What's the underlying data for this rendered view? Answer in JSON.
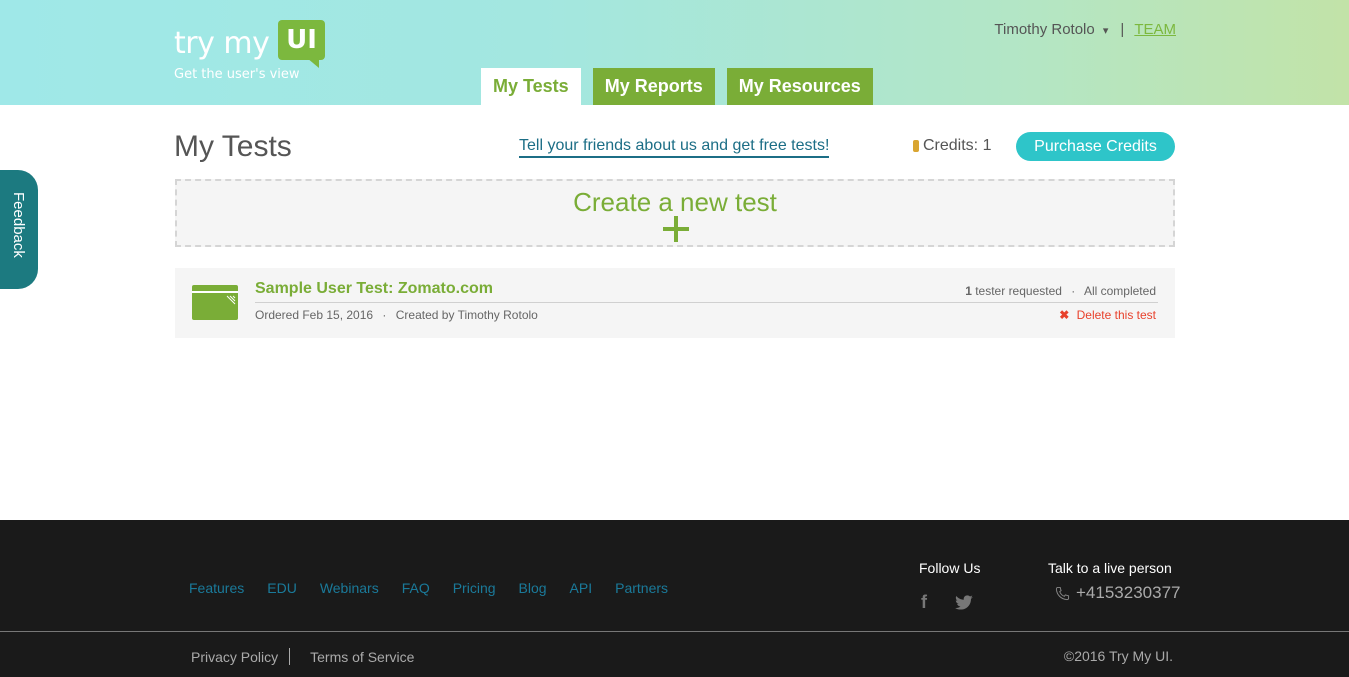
{
  "header": {
    "logo": {
      "text": "try my",
      "badge": "UI",
      "tagline": "Get the user's view"
    },
    "user": {
      "name": "Timothy Rotolo",
      "caret": "▾",
      "separator": "|",
      "team_label": "TEAM"
    },
    "tabs": [
      {
        "label": "My Tests",
        "active": true
      },
      {
        "label": "My Reports",
        "active": false
      },
      {
        "label": "My Resources",
        "active": false
      }
    ]
  },
  "feedback": {
    "label": "Feedback"
  },
  "main": {
    "title": "My Tests",
    "referral_link": "Tell your friends about us and get free tests!",
    "credits_label": "Credits: 1",
    "purchase_button": "Purchase Credits",
    "create_test": {
      "label": "Create a new test"
    },
    "tests": [
      {
        "name": "Sample User Test: Zomato.com",
        "ordered": "Ordered Feb 15, 2016",
        "created_by": "Created by Timothy Rotolo",
        "testers_count": "1",
        "testers_label": "tester requested",
        "status": "All completed",
        "delete_label": "Delete this test"
      }
    ]
  },
  "footer": {
    "links": [
      "Features",
      "EDU",
      "Webinars",
      "FAQ",
      "Pricing",
      "Blog",
      "API",
      "Partners"
    ],
    "follow_title": "Follow Us",
    "talk_title": "Talk to a live person",
    "phone": "+4153230377",
    "privacy": "Privacy Policy",
    "terms": "Terms of Service",
    "copyright": "©2016 Try My UI."
  },
  "colors": {
    "brand_green": "#7aad37",
    "accent_teal": "#2ec5c9",
    "feedback_teal": "#1c7a80",
    "delete_red": "#e8412c",
    "footer_bg": "#1a1a1a"
  }
}
